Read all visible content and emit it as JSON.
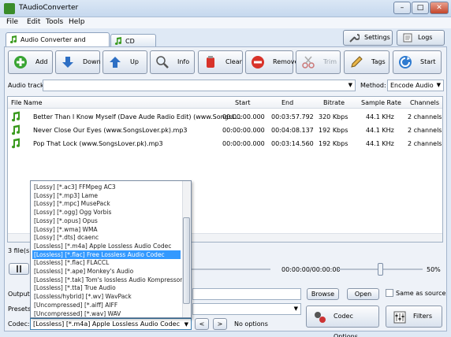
{
  "window": {
    "title": "TAudioConverter",
    "minimize": "–",
    "maximize": "□",
    "close": "✕"
  },
  "menu": [
    "File",
    "Edit",
    "Tools",
    "Help"
  ],
  "tabs": [
    {
      "label": "Audio Converter and Extractor",
      "icon": "music-note-icon"
    },
    {
      "label": "CD Ripper",
      "icon": "cd-icon"
    }
  ],
  "top_buttons": {
    "settings": "Settings",
    "logs": "Logs"
  },
  "toolbar": [
    {
      "label": "Add",
      "icon": "add-icon",
      "enabled": true
    },
    {
      "label": "Down",
      "icon": "arrow-down-icon",
      "enabled": true
    },
    {
      "label": "Up",
      "icon": "arrow-up-icon",
      "enabled": true
    },
    {
      "label": "Info",
      "icon": "magnifier-icon",
      "enabled": true
    },
    {
      "label": "Clear",
      "icon": "clear-icon",
      "enabled": true
    },
    {
      "label": "Remove",
      "icon": "remove-icon",
      "enabled": true
    },
    {
      "label": "Trim",
      "icon": "scissors-icon",
      "enabled": false
    },
    {
      "label": "Tags",
      "icon": "pencil-icon",
      "enabled": true
    },
    {
      "label": "Start",
      "icon": "start-icon",
      "enabled": true
    }
  ],
  "audio_track": {
    "label": "Audio track:",
    "value": ""
  },
  "method": {
    "label": "Method:",
    "value": "Encode Audio"
  },
  "file_list": {
    "columns": [
      "File Name",
      "Start",
      "End",
      "Bitrate",
      "Sample Rate",
      "Channels"
    ],
    "rows": [
      {
        "name": "Better Than I Know Myself (Dave Aude Radio Edit) (www.SongsL...",
        "start": "00:00:00.000",
        "end": "00:03:57.792",
        "bitrate": "320 Kbps",
        "sample_rate": "44.1 KHz",
        "channels": "2 channels"
      },
      {
        "name": "Never Close Our Eyes (www.SongsLover.pk).mp3",
        "start": "00:00:00.000",
        "end": "00:04:08.137",
        "bitrate": "192 Kbps",
        "sample_rate": "44.1 KHz",
        "channels": "2 channels"
      },
      {
        "name": "Pop That Lock (www.SongsLover.pk).mp3",
        "start": "00:00:00.000",
        "end": "00:03:14.560",
        "bitrate": "192 Kbps",
        "sample_rate": "44.1 KHz",
        "channels": "2 channels"
      }
    ]
  },
  "status": {
    "file_count": "3 file(s)"
  },
  "player": {
    "time": "00:00:00/00:00:00",
    "volume": "50%",
    "volume_level": 0.5
  },
  "output": {
    "label": "Output:",
    "browse": "Browse",
    "open": "Open",
    "same_as_source": "Same as source"
  },
  "presets": {
    "label": "Presets:"
  },
  "codec": {
    "label": "Codec:",
    "value": "[Lossless] [*.m4a] Apple Lossless Audio Codec",
    "prev": "<",
    "next": ">",
    "options_text": "No options",
    "codec_options": "Codec Options",
    "filters": "Filters",
    "dropdown_options": [
      "[Lossy] [*.ac3] FFMpeg AC3",
      "[Lossy] [*.mp3] Lame",
      "[Lossy] [*.mpc] MusePack",
      "[Lossy] [*.ogg] Ogg Vorbis",
      "[Lossy] [*.opus] Opus",
      "[Lossy] [*.wma] WMA",
      "[Lossy] [*.dts] dcaenc",
      "[Lossless] [*.m4a] Apple Lossless Audio Codec",
      "[Lossless] [*.flac] Free Lossless Audio Codec",
      "[Lossless] [*.flac] FLACCL",
      "[Lossless] [*.ape] Monkey's Audio",
      "[Lossless] [*.tak] Tom's lossless Audio Kompressor",
      "[Lossless] [*.tta] True Audio",
      "[Lossless/hybrid] [*.wv] WavPack",
      "[Uncompressed] [*.aiff] AIFF",
      "[Uncompressed] [*.wav] WAV"
    ],
    "selected_index": 8
  },
  "colors": {
    "accent": "#3399ff",
    "note_green": "#3a9a1e",
    "panel": "#eef2f8"
  }
}
